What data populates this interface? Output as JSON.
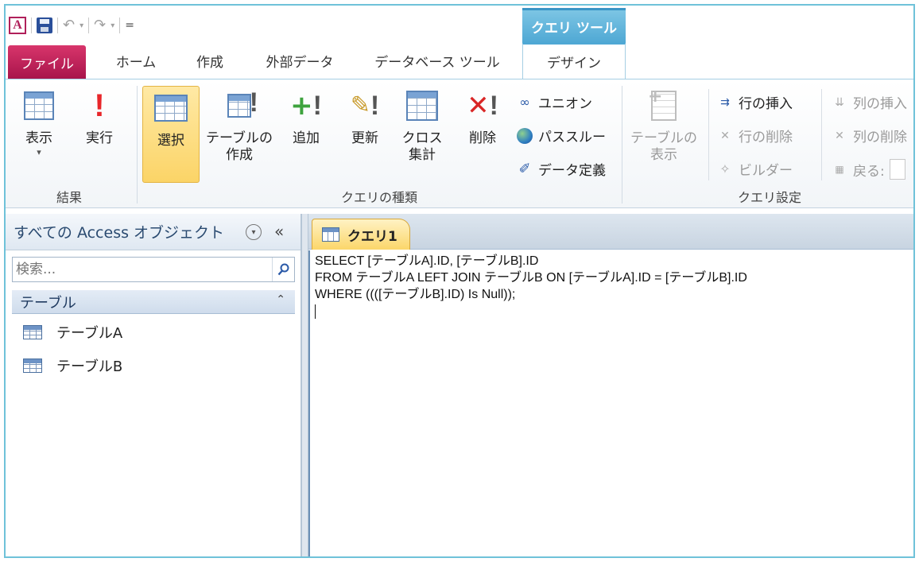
{
  "qat": {
    "app_icon": "A",
    "undo": "↶",
    "redo": "↷",
    "dropdown": "▾",
    "customize": "="
  },
  "context_tab": {
    "header": "クエリ ツール"
  },
  "tabs": {
    "file": "ファイル",
    "home": "ホーム",
    "create": "作成",
    "external": "外部データ",
    "dbtools": "データベース ツール",
    "design": "デザイン"
  },
  "ribbon": {
    "results": {
      "label": "結果",
      "view": "表示",
      "view_arrow": "▾",
      "run": "実行"
    },
    "query_type": {
      "label": "クエリの種類",
      "select": "選択",
      "make_table_1": "テーブルの",
      "make_table_2": "作成",
      "append": "追加",
      "update": "更新",
      "crosstab_1": "クロス",
      "crosstab_2": "集計",
      "delete": "削除",
      "union": "ユニオン",
      "passthrough": "パススルー",
      "data_definition": "データ定義"
    },
    "query_setup": {
      "label": "クエリ設定",
      "show_table_1": "テーブルの",
      "show_table_2": "表示",
      "insert_rows": "行の挿入",
      "delete_rows": "行の削除",
      "builder": "ビルダー",
      "insert_columns": "列の挿入",
      "delete_columns": "列の削除",
      "return": "戻る:"
    }
  },
  "nav": {
    "title": "すべての Access オブジェクト",
    "circle_glyph": "▾",
    "collapse_glyph": "«",
    "search_placeholder": "検索...",
    "category": "テーブル",
    "category_glyph": "⌃",
    "items": [
      "テーブルA",
      "テーブルB"
    ]
  },
  "document": {
    "tab_label": "クエリ1",
    "sql_lines": [
      "SELECT [テーブルA].ID, [テーブルB].ID",
      "FROM テーブルA LEFT JOIN テーブルB ON [テーブルA].ID = [テーブルB].ID",
      "WHERE ((([テーブルB].ID) Is Null));"
    ]
  }
}
